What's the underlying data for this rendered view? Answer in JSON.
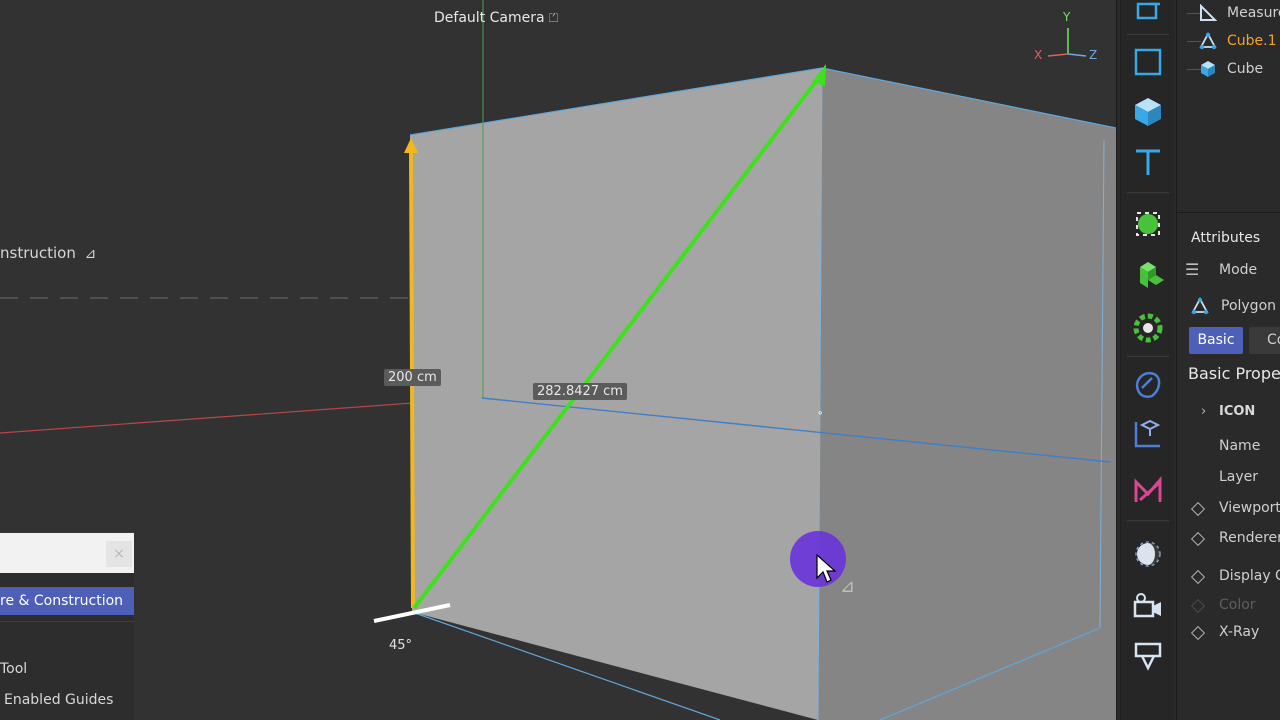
{
  "viewport": {
    "camera_label": "Default Camera",
    "tool_hint": "nstruction",
    "measure_vertical": "200 cm",
    "measure_diagonal": "282.8427 cm",
    "angle": "45°",
    "axis_y": "Y",
    "axis_x": "X",
    "axis_z": "Z"
  },
  "popup": {
    "close_label": "×",
    "selected_item": "re & Construction",
    "items": [
      "Tool",
      "Enabled Guides"
    ]
  },
  "toolbar": {
    "icons": [
      "export-icon",
      "rectangle-icon",
      "cube-icon",
      "text-icon",
      "modeling-icon",
      "mograph-cloner-icon",
      "deformer-icon",
      "field-icon",
      "object-symmetry-icon",
      "spline-pen-icon",
      "light-icon",
      "camera-icon",
      "render-output-icon"
    ]
  },
  "objects": {
    "rows": [
      {
        "name": "Measure",
        "color": "#cfcfcf",
        "icon": "measure-icon"
      },
      {
        "name": "Cube.1",
        "color": "#f2a22d",
        "icon": "polygon-object-icon"
      },
      {
        "name": "Cube",
        "color": "#cfcfcf",
        "icon": "cube-icon"
      }
    ]
  },
  "attributes": {
    "title": "Attributes",
    "mode_label": "Mode",
    "object_type": "Polygon",
    "tab_basic": "Basic",
    "tab_coord": "Co",
    "section": "Basic Proper",
    "icon_group": "ICON",
    "fields": [
      "Name",
      "Layer",
      "Viewport",
      "Renderer",
      "Display C",
      "Color",
      "X-Ray"
    ]
  },
  "colors": {
    "accent": "#4e5fb8",
    "selected_object": "#f2a22d",
    "measure_green": "#3fe11f",
    "measure_yellow": "#f2b81b",
    "cursor": "#6a35d8"
  }
}
